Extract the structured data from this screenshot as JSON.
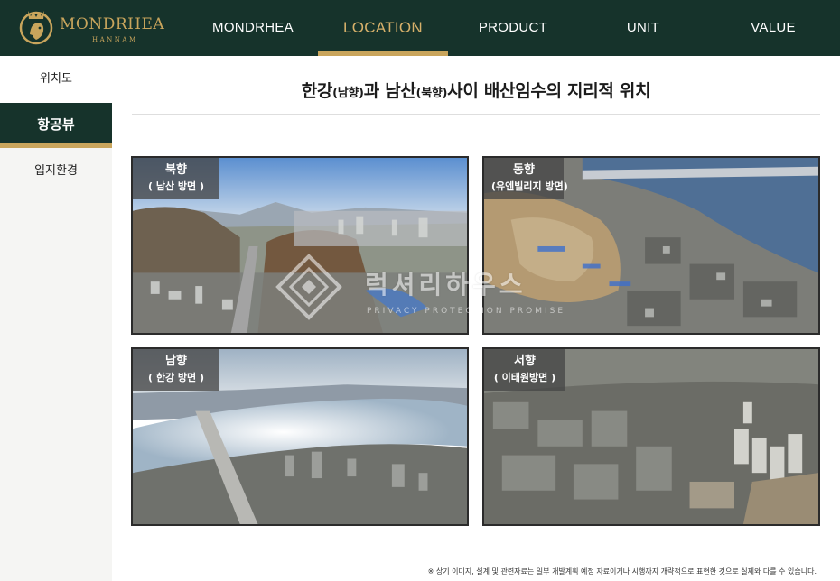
{
  "brand": {
    "name": "MONDRHEA",
    "sub": "HANNAM",
    "gold": "#c9a55c",
    "dark_green": "#16332b"
  },
  "nav": {
    "items": [
      {
        "label": "MONDRHEA",
        "active": false
      },
      {
        "label": "LOCATION",
        "active": true
      },
      {
        "label": "PRODUCT",
        "active": false
      },
      {
        "label": "UNIT",
        "active": false
      },
      {
        "label": "VALUE",
        "active": false
      }
    ]
  },
  "sidebar": {
    "items": [
      {
        "label": "위치도",
        "active": false
      },
      {
        "label": "항공뷰",
        "active": true
      },
      {
        "label": "입지환경",
        "active": false
      }
    ]
  },
  "main": {
    "title_part1": "한강",
    "title_paren1": "(남향)",
    "title_part2": "과 남산",
    "title_paren2": "(북향)",
    "title_part3": "사이 배산임수의 지리적 위치"
  },
  "views": [
    {
      "direction": "북향",
      "subtitle": "( 남산 방면 )"
    },
    {
      "direction": "동향",
      "subtitle": "(유엔빌리지 방면)"
    },
    {
      "direction": "남향",
      "subtitle": "( 한강 방면 )"
    },
    {
      "direction": "서향",
      "subtitle": "( 이태원방면 )"
    }
  ],
  "watermark": {
    "text": "럭셔리하우스",
    "sub": "PRIVACY PROTECTION PROMISE"
  },
  "footnote": "※ 상기 이미지, 설계 및 관련자료는 일부 개발계획 예정 자료이거나 시행까지 개략적으로 표현한 것으로 실제와 다를 수 있습니다."
}
